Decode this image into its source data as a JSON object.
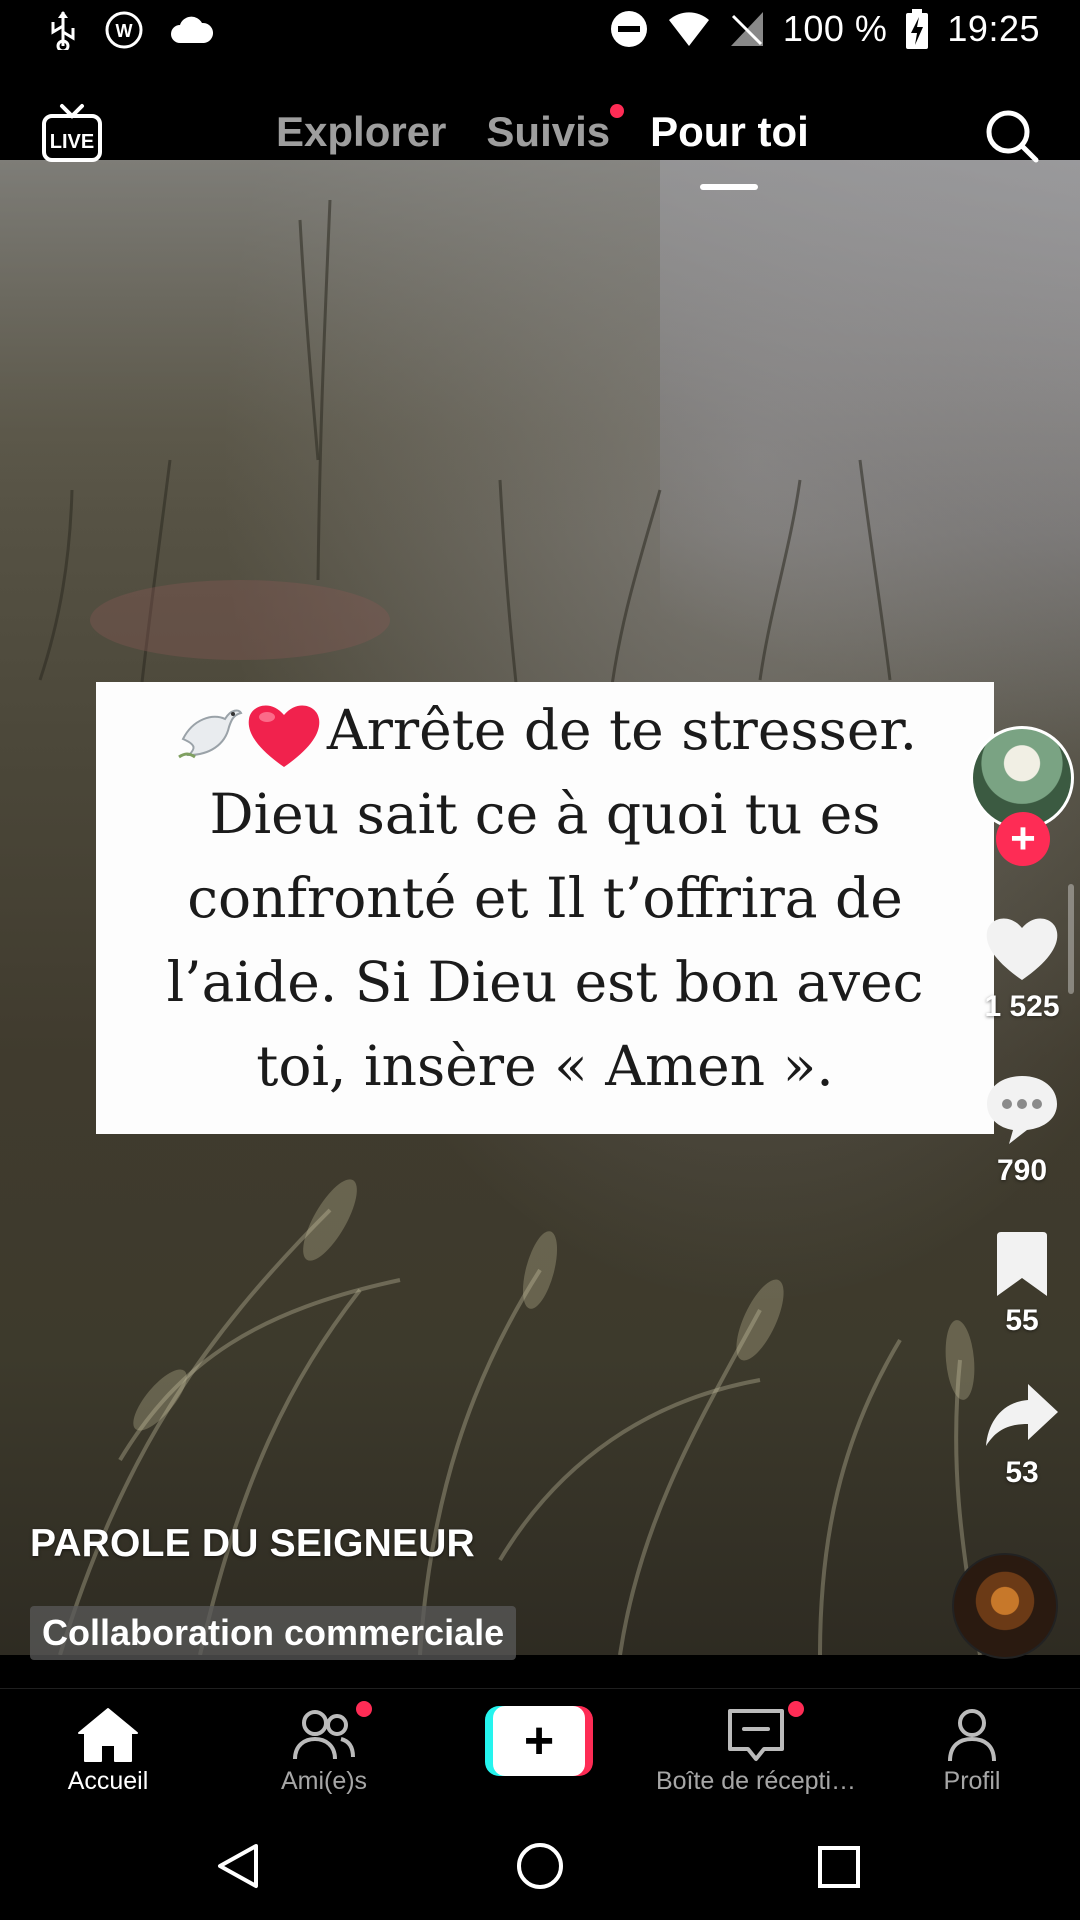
{
  "status_bar": {
    "battery": "100 %",
    "time": "19:25"
  },
  "top_nav": {
    "tabs": [
      {
        "label": "Explorer",
        "active": false,
        "notification_dot": false
      },
      {
        "label": "Suivis",
        "active": false,
        "notification_dot": true
      },
      {
        "label": "Pour toi",
        "active": true,
        "notification_dot": false
      }
    ],
    "icons": [
      "live-icon",
      "search-icon"
    ]
  },
  "video": {
    "quote_lines": [
      "Arrête de te stresser.",
      "Dieu sait ce à quoi tu es",
      "confronté et Il t’offrira de",
      "l’aide. Si Dieu est bon avec",
      "toi, insère « Amen »."
    ],
    "quote_emojis": [
      "dove-emoji",
      "heart-emoji"
    ]
  },
  "actions": {
    "likes": "1 525",
    "comments": "790",
    "saves": "55",
    "shares": "53"
  },
  "caption": {
    "author": "PAROLE DU SEIGNEUR",
    "badge": "Collaboration commerciale"
  },
  "bottom_nav": {
    "home": "Accueil",
    "friends": "Ami(e)s",
    "inbox": "Boîte de récepti…",
    "profile": "Profil"
  },
  "colors": {
    "accent_red": "#fe2c55",
    "accent_cyan": "#25f4ee",
    "background": "#000000"
  }
}
